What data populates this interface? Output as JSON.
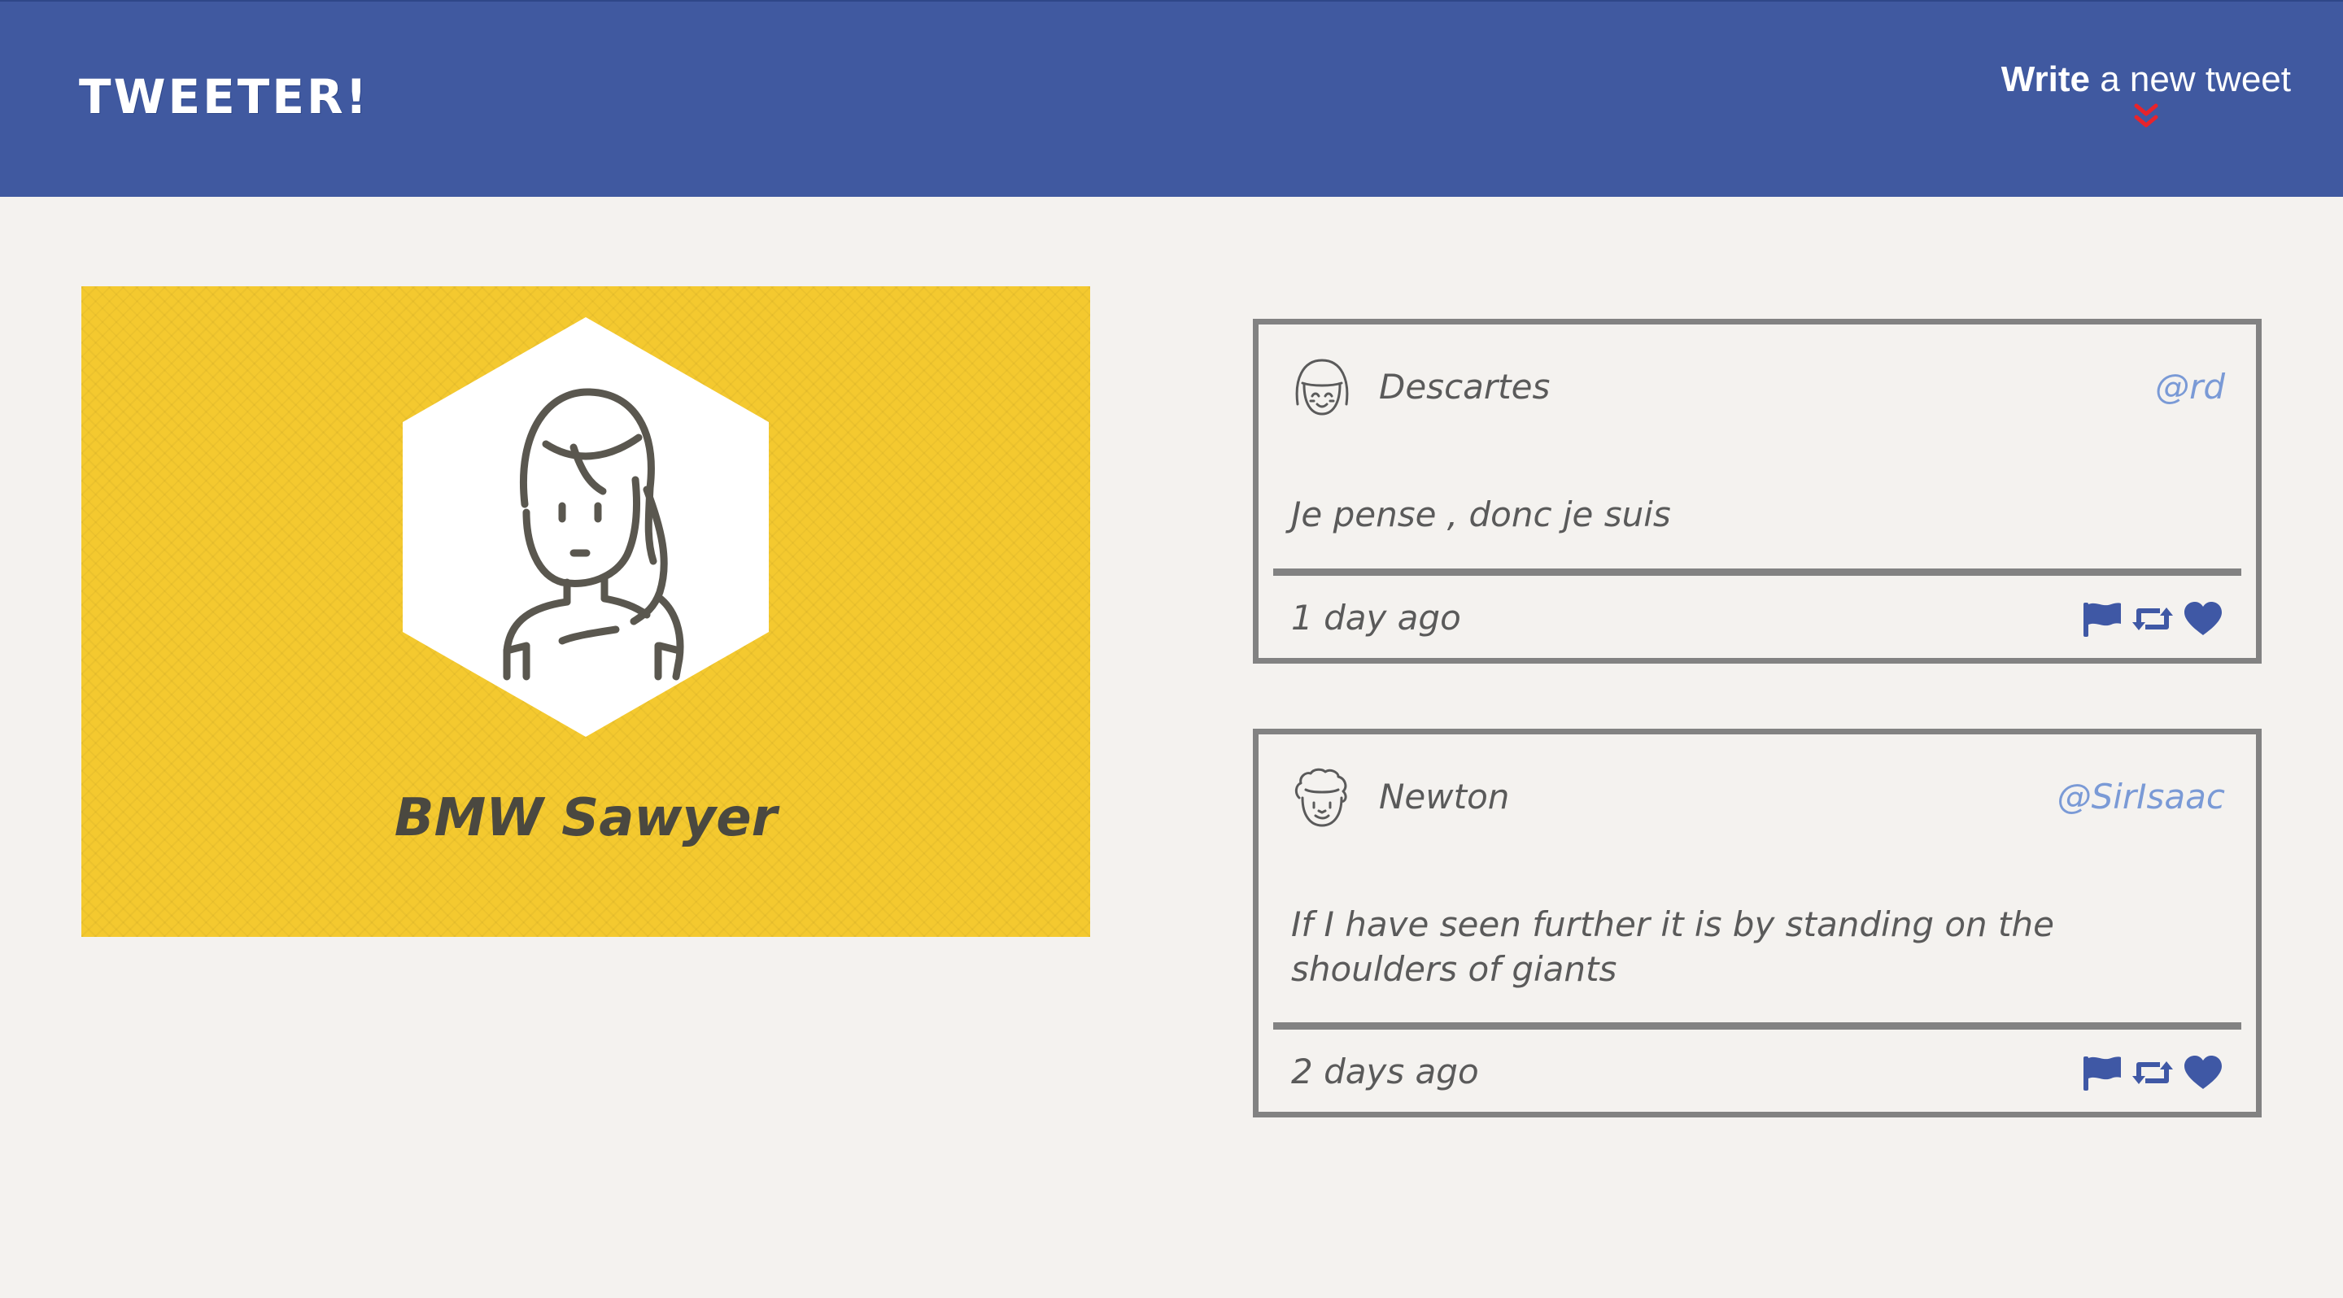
{
  "header": {
    "brand": "TWEETER!",
    "compose_bold": "Write",
    "compose_rest": " a new tweet",
    "compose_icon": "double-chevron-down-icon"
  },
  "profile": {
    "name": "BMW Sawyer",
    "avatar_icon": "woman-avatar-icon"
  },
  "tweets": [
    {
      "author": "Descartes",
      "handle": "@rd",
      "content": "Je pense , donc je suis",
      "time": "1 day ago",
      "avatar_icon": "girl-avatar-icon"
    },
    {
      "author": "Newton",
      "handle": "@SirIsaac",
      "content": "If I have seen further it is by standing on the shoulders of giants",
      "time": "2 days ago",
      "avatar_icon": "curly-hair-avatar-icon"
    }
  ],
  "actions": [
    "flag-icon",
    "retweet-icon",
    "heart-icon"
  ],
  "colors": {
    "header": "#4059a0",
    "page": "#f4f2ef",
    "profile": "#f4c92f",
    "accent_icons": "#3f58a5",
    "handle": "#7a9ad6",
    "chevron": "#e8232b",
    "border": "#828282"
  }
}
